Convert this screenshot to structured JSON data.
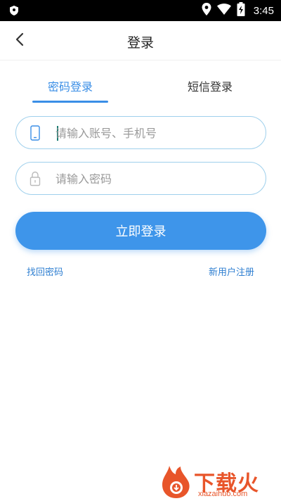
{
  "status_bar": {
    "time": "3:45",
    "icons": [
      "shield-icon",
      "location-icon",
      "wifi-icon",
      "battery-charging-icon"
    ]
  },
  "header": {
    "back_icon": "chevron-left-icon",
    "title": "登录"
  },
  "tabs": [
    {
      "label": "密码登录",
      "active": true
    },
    {
      "label": "短信登录",
      "active": false
    }
  ],
  "form": {
    "account": {
      "icon": "phone-icon",
      "placeholder": "请输入账号、手机号",
      "value": ""
    },
    "password": {
      "icon": "lock-icon",
      "placeholder": "请输入密码",
      "value": ""
    },
    "submit_label": "立即登录"
  },
  "links": {
    "forgot": "找回密码",
    "register": "新用户注册"
  },
  "watermark": {
    "brand": "下载火",
    "url": "xiazaihuo.com"
  },
  "colors": {
    "accent": "#3a8ee6",
    "button": "#3e95ea",
    "field_border": "#9fd0ec",
    "watermark": "#e8552a"
  }
}
